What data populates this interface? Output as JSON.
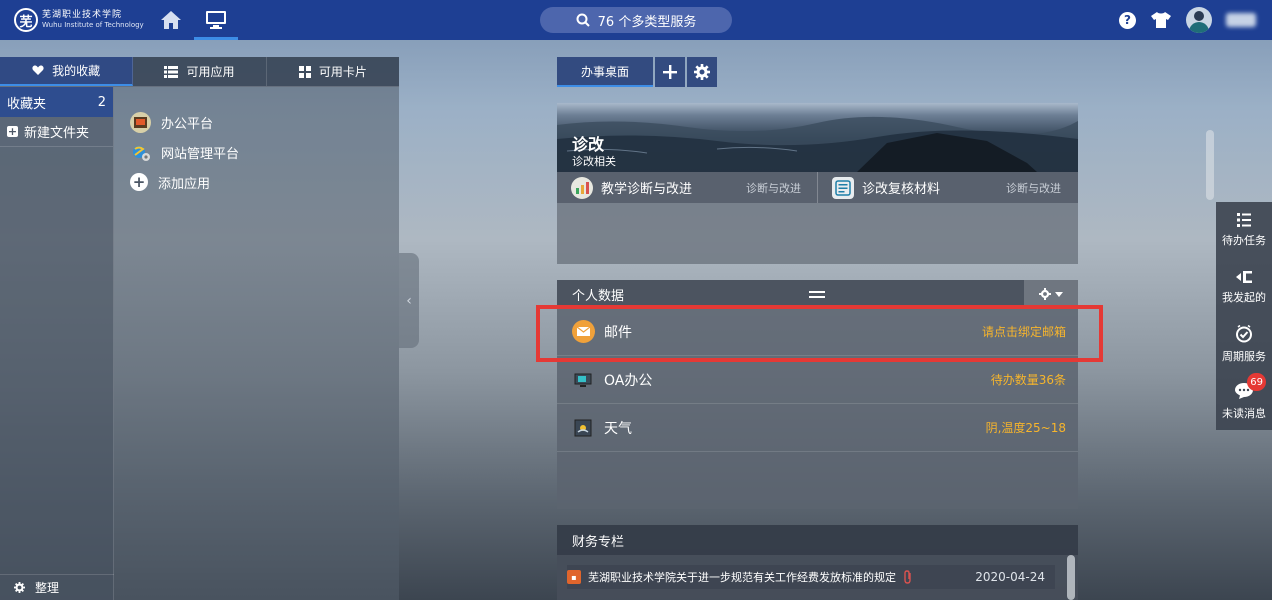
{
  "header": {
    "logo_char": "芜",
    "logo_name_cn": "芜湖职业技术学院",
    "logo_name_en": "Wuhu Institute of Technology",
    "search_label": "76 个多类型服务"
  },
  "left_panel": {
    "tabs": [
      {
        "label": "我的收藏",
        "icon": "heart-icon",
        "active": true
      },
      {
        "label": "可用应用",
        "icon": "list-icon",
        "active": false
      },
      {
        "label": "可用卡片",
        "icon": "grid-icon",
        "active": false
      }
    ],
    "folders": [
      {
        "label": "收藏夹",
        "count": "2"
      }
    ],
    "new_folder_label": "新建文件夹",
    "organize_label": "整理",
    "apps": [
      {
        "label": "办公平台",
        "icon": "office-platform-icon"
      },
      {
        "label": "网站管理平台",
        "icon": "website-management-icon"
      },
      {
        "label": "添加应用",
        "icon": "add-app-icon"
      }
    ]
  },
  "desk": {
    "tab_label": "办事桌面",
    "add_label": "+"
  },
  "card_diagnosis": {
    "title": "诊改",
    "subtitle": "诊改相关",
    "links": [
      {
        "label": "教学诊断与改进",
        "tag": "诊断与改进",
        "icon": "chart-icon"
      },
      {
        "label": "诊改复核材料",
        "tag": "诊断与改进",
        "icon": "review-material-icon"
      }
    ]
  },
  "card_personal": {
    "title": "个人数据",
    "rows": [
      {
        "label": "邮件",
        "status": "请点击绑定邮箱",
        "icon": "mail-icon"
      },
      {
        "label": "OA办公",
        "status": "待办数量36条",
        "icon": "oa-office-icon"
      },
      {
        "label": "天气",
        "status": "阴,温度25~18",
        "icon": "weather-icon"
      }
    ]
  },
  "card_finance": {
    "title": "财务专栏",
    "items": [
      {
        "title": "芜湖职业技术学院关于进一步规范有关工作经费发放标准的规定",
        "date": "2020-04-24"
      }
    ]
  },
  "dock": [
    {
      "label": "待办任务",
      "icon": "task-list-icon"
    },
    {
      "label": "我发起的",
      "icon": "initiated-icon"
    },
    {
      "label": "周期服务",
      "icon": "clock-check-icon"
    },
    {
      "label": "未读消息",
      "icon": "chat-icon",
      "badge": "69"
    }
  ],
  "colors": {
    "topbar": "#1e3f93",
    "accent": "#3d8de6",
    "status_orange": "#f7b52c",
    "highlight_red": "#e53935"
  }
}
